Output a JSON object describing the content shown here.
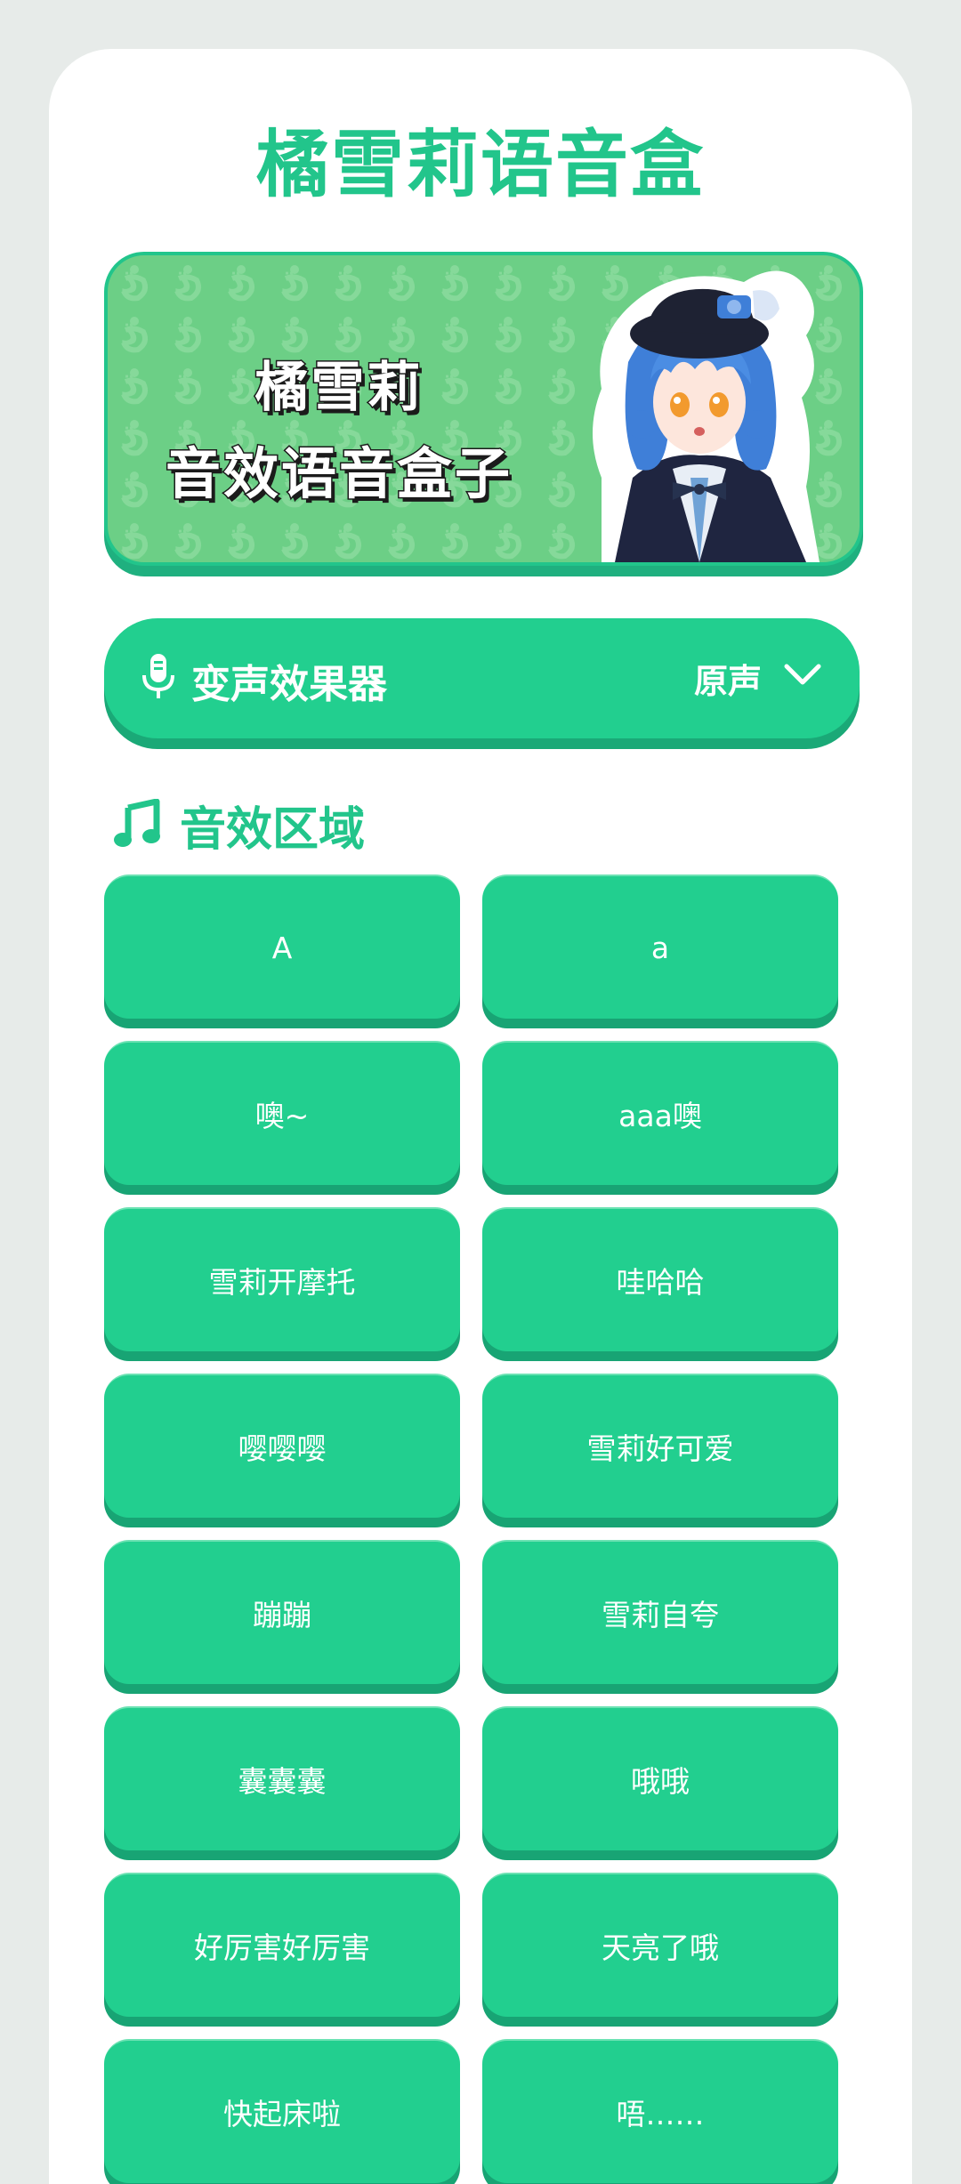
{
  "app": {
    "title": "橘雪莉语音盒"
  },
  "banner": {
    "line1": "橘雪莉",
    "line2": "音效语音盒子"
  },
  "voice_changer": {
    "label": "变声效果器",
    "value": "原声",
    "icon": "microphone-icon",
    "dropdown_icon": "chevron-down-icon"
  },
  "section": {
    "title": "音效区域",
    "icon": "music-note-icon"
  },
  "sounds": [
    {
      "label": "A"
    },
    {
      "label": "a"
    },
    {
      "label": "噢~"
    },
    {
      "label": "aaa噢"
    },
    {
      "label": "雪莉开摩托"
    },
    {
      "label": "哇哈哈"
    },
    {
      "label": "嘤嘤嘤"
    },
    {
      "label": "雪莉好可爱"
    },
    {
      "label": "蹦蹦"
    },
    {
      "label": "雪莉自夸"
    },
    {
      "label": "囊囊囊"
    },
    {
      "label": "哦哦"
    },
    {
      "label": "好厉害好厉害"
    },
    {
      "label": "天亮了哦"
    },
    {
      "label": "快起床啦"
    },
    {
      "label": "唔……"
    }
  ],
  "colors": {
    "accent": "#22c58b",
    "button": "#22cf8f",
    "button_shadow": "#18a474",
    "banner_bg": "#6ccf86",
    "page_bg": "#e7ebe9"
  }
}
